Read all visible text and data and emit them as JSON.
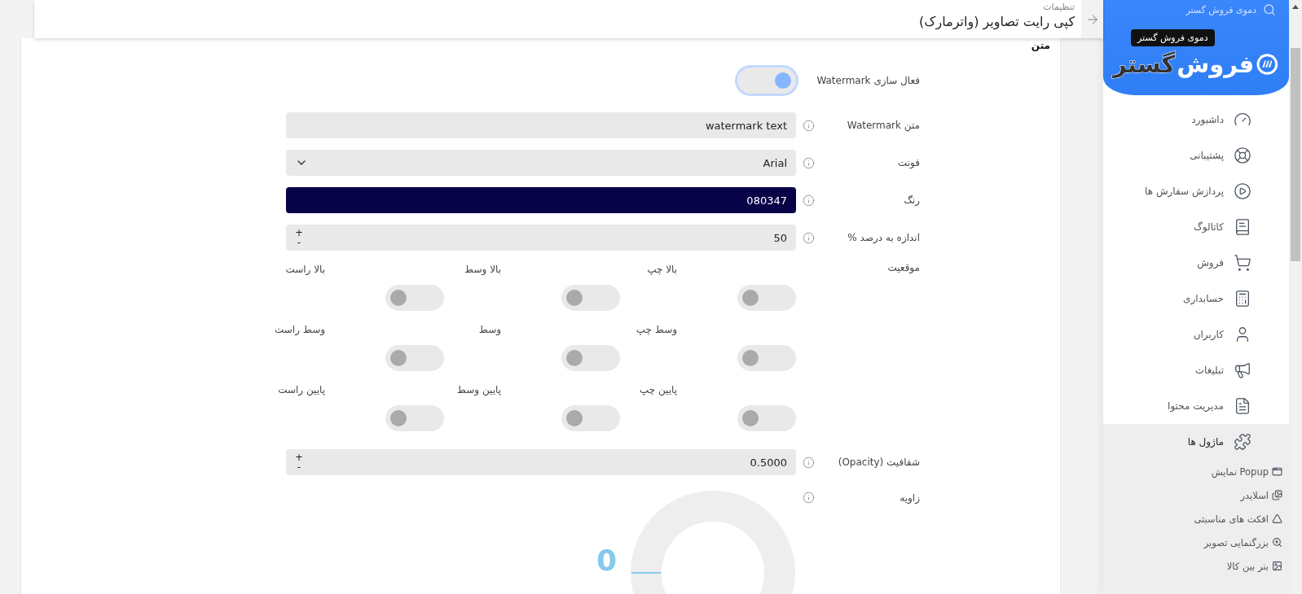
{
  "sidebar": {
    "search_text": "دموی فروش گستر",
    "tooltip": "دموی فروش گستر",
    "logo": {
      "primary": "فروش",
      "secondary": "گستر"
    },
    "items": [
      {
        "label": "داشبورد",
        "selected": false
      },
      {
        "label": "پشتیبانی",
        "selected": false
      },
      {
        "label": "پردازش سفارش ها",
        "selected": false
      },
      {
        "label": "کاتالوگ",
        "selected": false
      },
      {
        "label": "فروش",
        "selected": false
      },
      {
        "label": "حسابداری",
        "selected": false
      },
      {
        "label": "کاربران",
        "selected": false
      },
      {
        "label": "تبلیغات",
        "selected": false
      },
      {
        "label": "مدیریت محتوا",
        "selected": false
      },
      {
        "label": "ماژول ها",
        "selected": true,
        "children": [
          {
            "label": "Popup نمایش",
            "selected": false
          },
          {
            "label": "اسلایدر",
            "selected": false
          },
          {
            "label": "افکت های مناسبتی",
            "selected": false
          },
          {
            "label": "بزرگنمایی تصویر",
            "selected": false
          },
          {
            "label": "بنر بین کالا",
            "selected": false
          }
        ]
      }
    ]
  },
  "header": {
    "breadcrumb": "تنظیمات",
    "title": "کپی رایت تصاویر (واترمارک)"
  },
  "section_title": "متن",
  "fields": [
    {
      "kind": "switch",
      "label": "فعال سازی Watermark",
      "info": false,
      "on": true
    },
    {
      "kind": "text",
      "label": "متن Watermark",
      "info": true,
      "value": "watermark text"
    },
    {
      "kind": "select",
      "label": "فونت",
      "info": true,
      "value": "Arial"
    },
    {
      "kind": "color",
      "label": "رنگ",
      "info": true,
      "value": "080347"
    },
    {
      "kind": "number",
      "label": "اندازه به درصد %",
      "info": true,
      "value": "50",
      "stepper": [
        "+",
        "-"
      ]
    },
    {
      "kind": "positions",
      "label": "موقعیت",
      "info": false,
      "options": [
        {
          "label": "بالا چپ",
          "on": false
        },
        {
          "label": "بالا وسط",
          "on": false
        },
        {
          "label": "بالا راست",
          "on": false
        },
        {
          "label": "وسط چپ",
          "on": false
        },
        {
          "label": "وسط",
          "on": false
        },
        {
          "label": "وسط راست",
          "on": false
        },
        {
          "label": "پایین چپ",
          "on": false
        },
        {
          "label": "پایین وسط",
          "on": false
        },
        {
          "label": "پایین راست",
          "on": false
        }
      ]
    },
    {
      "kind": "number",
      "label": "شفافیت (Opacity)",
      "info": true,
      "value": "0.5000",
      "stepper": [
        "+",
        "-"
      ]
    },
    {
      "kind": "angle",
      "label": "زاویه",
      "info": true,
      "value": "0"
    }
  ]
}
